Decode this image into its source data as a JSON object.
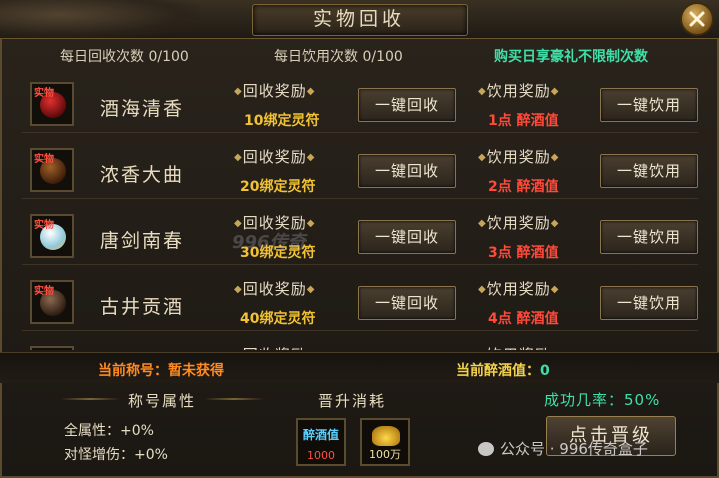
{
  "window": {
    "title": "实物回收"
  },
  "counts": {
    "recycle_daily": "每日回收次数 0/100",
    "drink_daily": "每日饮用次数 0/100",
    "vip_note": "购买日享豪礼不限制次数"
  },
  "common": {
    "recycle_reward_label": "回收奖励",
    "drink_reward_label": "饮用奖励",
    "recycle_button": "一键回收",
    "drink_button": "一键饮用",
    "item_tag": "实物"
  },
  "items": [
    {
      "name": "酒海清香",
      "recycle_reward": "10绑定灵符",
      "drink_reward": "1点 醉酒值",
      "icon": "red-wine-jar-icon",
      "color": "#b01818"
    },
    {
      "name": "浓香大曲",
      "recycle_reward": "20绑定灵符",
      "drink_reward": "2点 醉酒值",
      "icon": "brown-wine-jar-icon",
      "color": "#7a3a1a"
    },
    {
      "name": "唐剑南春",
      "recycle_reward": "30绑定灵符",
      "drink_reward": "3点 醉酒值",
      "icon": "porcelain-bottle-icon",
      "color": "#cfe8f0"
    },
    {
      "name": "古井贡酒",
      "recycle_reward": "40绑定灵符",
      "drink_reward": "4点 醉酒值",
      "icon": "clay-wine-jar-icon",
      "color": "#5a4030"
    }
  ],
  "status": {
    "current_title": "当前称号：暂未获得",
    "current_drunk_label": "当前醉酒值：",
    "current_drunk_value": "0"
  },
  "attributes": {
    "header": "称号属性",
    "all_attr": "全属性：+0%",
    "monster_dmg": "对怪增伤：+0%"
  },
  "upgrade": {
    "cost_header": "晋升消耗",
    "cost1_label": "醉酒值",
    "cost1_qty": "1000",
    "cost2_qty": "100万",
    "rate_label": "成功几率：",
    "rate_value": "50%",
    "button": "点击晋级"
  },
  "watermarks": {
    "center": "996传奇",
    "corner": "公众号 · 996传奇盒子"
  }
}
